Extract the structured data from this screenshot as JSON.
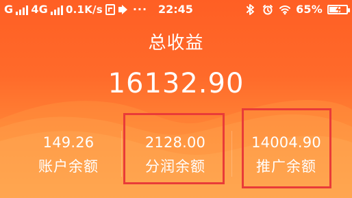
{
  "status_bar": {
    "carrier_1": "G",
    "carrier_2": "4G",
    "network_speed": "0.1K/s",
    "time": "22:45",
    "battery_text": "65%",
    "icons": {
      "signal_1": "signal-icon",
      "signal_2": "signal-icon",
      "storage": "storage-icon",
      "volume": "speaker-icon",
      "bluetooth": "bluetooth-icon",
      "alarm": "alarm-icon",
      "wifi": "wifi-icon",
      "battery": "battery-icon"
    },
    "battery_level": 0.65
  },
  "summary": {
    "title": "总收益",
    "amount": "16132.90"
  },
  "stats": [
    {
      "value": "149.26",
      "label": "账户余额"
    },
    {
      "value": "2128.00",
      "label": "分润余额"
    },
    {
      "value": "14004.90",
      "label": "推广余额"
    }
  ],
  "colors": {
    "background_top": "#ff5f24",
    "background_bottom": "#ffa04a",
    "highlight": "#e93b38",
    "text": "#ffffff"
  }
}
